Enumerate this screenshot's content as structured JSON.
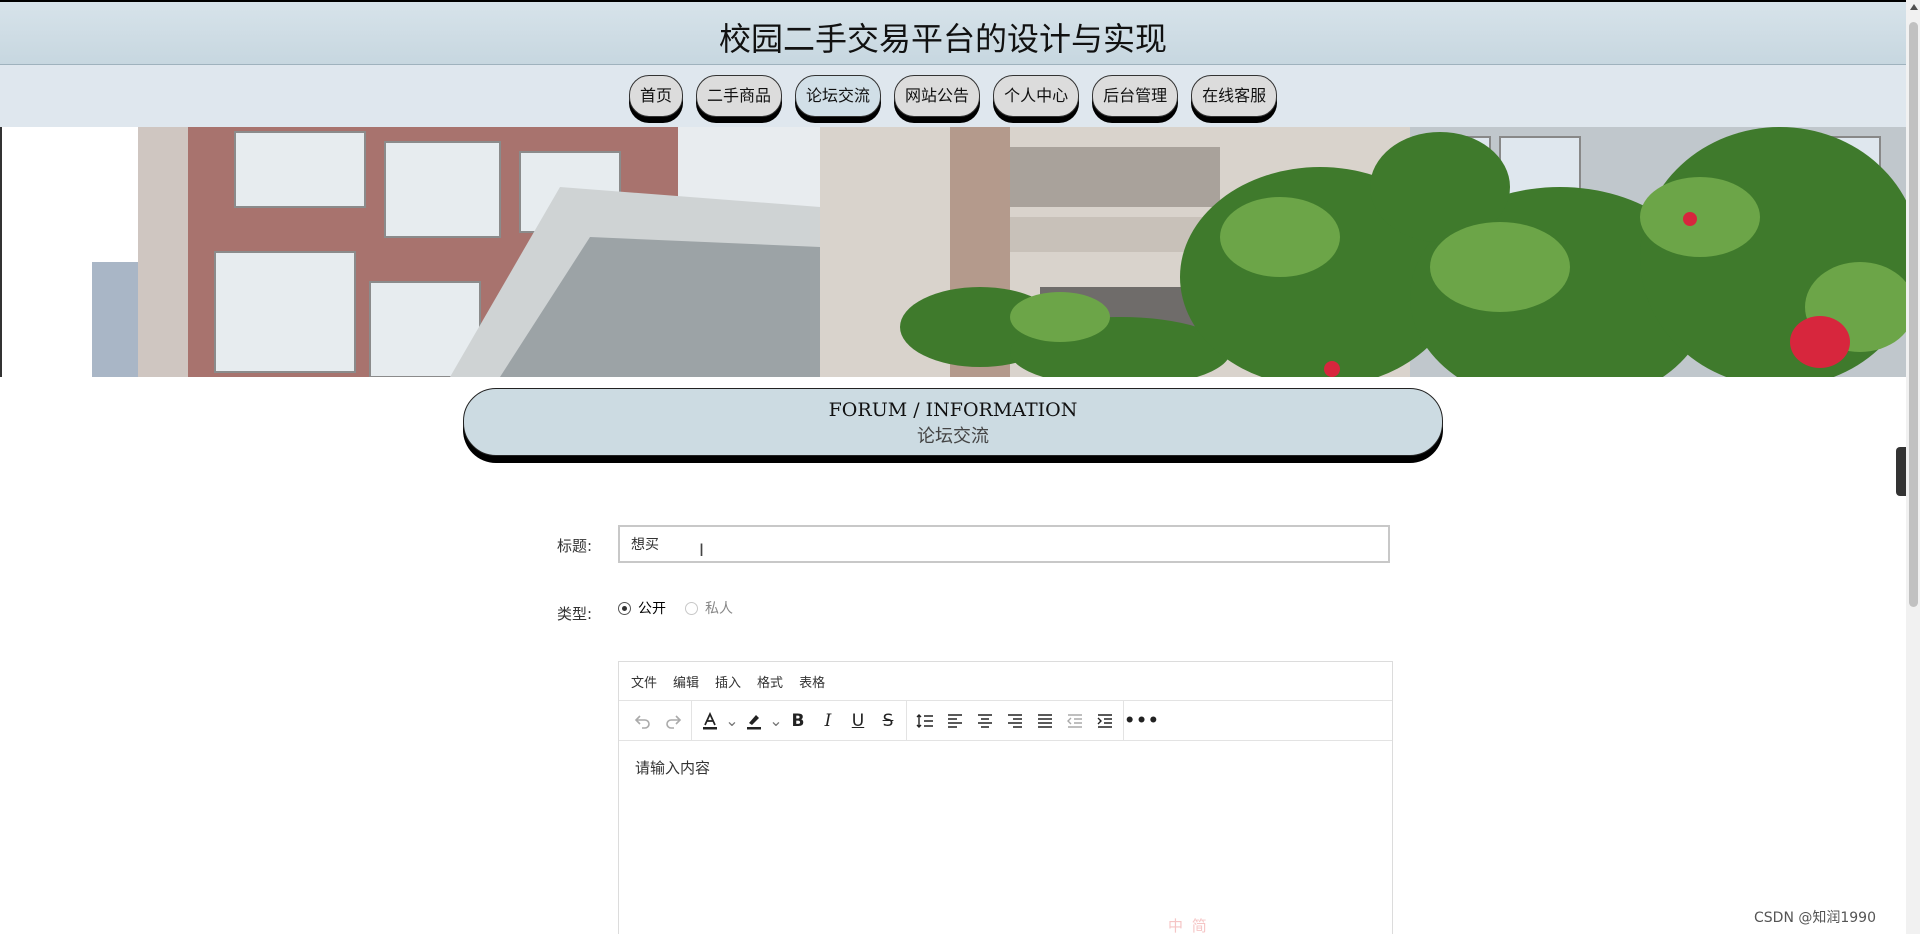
{
  "site": {
    "title": "校园二手交易平台的设计与实现"
  },
  "nav": {
    "items": [
      {
        "label": "首页"
      },
      {
        "label": "二手商品"
      },
      {
        "label": "论坛交流"
      },
      {
        "label": "网站公告"
      },
      {
        "label": "个人中心"
      },
      {
        "label": "后台管理"
      },
      {
        "label": "在线客服"
      }
    ],
    "active": "论坛交流"
  },
  "section": {
    "title_en": "FORUM / INFORMATION",
    "title_cn": "论坛交流"
  },
  "form": {
    "title_label": "标题:",
    "title_value": "想买",
    "type_label": "类型:",
    "type_options": [
      {
        "label": "公开",
        "checked": true
      },
      {
        "label": "私人",
        "checked": false
      }
    ]
  },
  "editor": {
    "menu": [
      "文件",
      "编辑",
      "插入",
      "格式",
      "表格"
    ],
    "toolbar_icons": [
      "undo-icon",
      "redo-icon",
      "font-color-icon",
      "highlight-icon",
      "bold-icon",
      "italic-icon",
      "underline-icon",
      "strikethrough-icon",
      "line-height-icon",
      "align-left-icon",
      "align-center-icon",
      "align-right-icon",
      "align-justify-icon",
      "outdent-icon",
      "indent-icon",
      "more-icon"
    ],
    "placeholder": "请输入内容"
  },
  "watermark": "CSDN @知润1990",
  "ime_toolbar": "中 简"
}
